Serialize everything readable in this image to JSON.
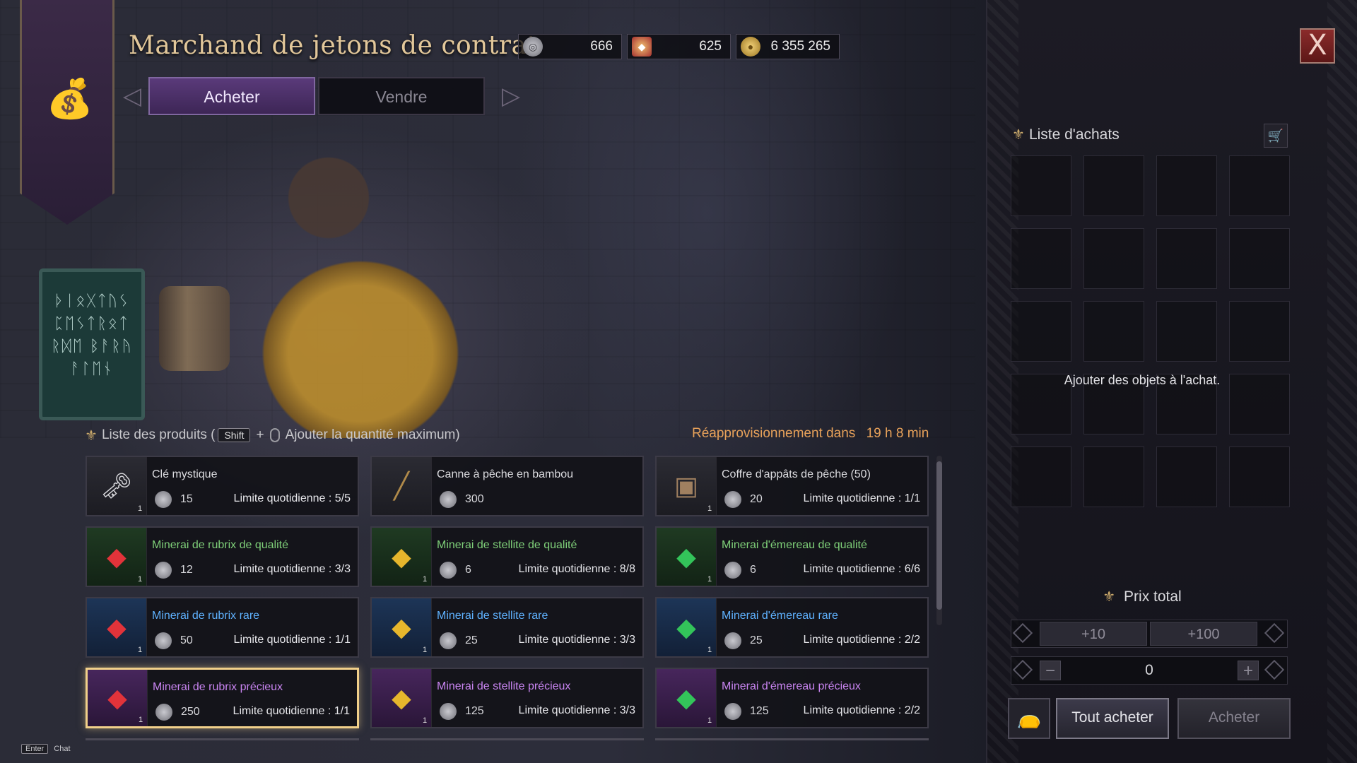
{
  "header": {
    "title": "Marchand de jetons de contrat",
    "currencies": [
      {
        "icon": "contract-token-icon",
        "value": "666"
      },
      {
        "icon": "ticket-icon",
        "value": "625"
      },
      {
        "icon": "gold-coin-icon",
        "value": "6 355 265"
      }
    ],
    "close_label": "X"
  },
  "tabs": {
    "buy": "Acheter",
    "sell": "Vendre"
  },
  "product_list": {
    "header_prefix": "Liste des produits (",
    "shift_key": "Shift",
    "plus": "+",
    "header_suffix": "Ajouter la quantité maximum)",
    "restock_label": "Réapprovisionnement dans",
    "restock_time": "19 h 8 min"
  },
  "items": [
    {
      "name": "Clé mystique",
      "price": "15",
      "limit": "Limite quotidienne : 5/5",
      "qty": "1",
      "grade": "normal",
      "icon": "key-icon"
    },
    {
      "name": "Canne à pêche en bambou",
      "price": "300",
      "limit": "",
      "qty": "",
      "grade": "normal",
      "icon": "fishing-rod-icon"
    },
    {
      "name": "Coffre d'appâts de pêche (50)",
      "price": "20",
      "limit": "Limite quotidienne : 1/1",
      "qty": "1",
      "grade": "normal",
      "icon": "bait-chest-icon"
    },
    {
      "name": "Minerai de rubrix de qualité",
      "price": "12",
      "limit": "Limite quotidienne : 3/3",
      "qty": "1",
      "grade": "green",
      "icon": "red-ore-icon"
    },
    {
      "name": "Minerai de stellite de qualité",
      "price": "6",
      "limit": "Limite quotidienne : 8/8",
      "qty": "1",
      "grade": "green",
      "icon": "yellow-ore-icon"
    },
    {
      "name": "Minerai d'émereau de qualité",
      "price": "6",
      "limit": "Limite quotidienne : 6/6",
      "qty": "1",
      "grade": "green",
      "icon": "green-ore-icon"
    },
    {
      "name": "Minerai de rubrix rare",
      "price": "50",
      "limit": "Limite quotidienne : 1/1",
      "qty": "1",
      "grade": "blue",
      "icon": "red-ore-icon"
    },
    {
      "name": "Minerai de stellite rare",
      "price": "25",
      "limit": "Limite quotidienne : 3/3",
      "qty": "1",
      "grade": "blue",
      "icon": "yellow-ore-icon"
    },
    {
      "name": "Minerai d'émereau rare",
      "price": "25",
      "limit": "Limite quotidienne : 2/2",
      "qty": "1",
      "grade": "blue",
      "icon": "green-ore-icon"
    },
    {
      "name": "Minerai de rubrix précieux",
      "price": "250",
      "limit": "Limite quotidienne : 1/1",
      "qty": "1",
      "grade": "purple",
      "icon": "red-ore-icon"
    },
    {
      "name": "Minerai de stellite précieux",
      "price": "125",
      "limit": "Limite quotidienne : 3/3",
      "qty": "1",
      "grade": "purple",
      "icon": "yellow-ore-icon"
    },
    {
      "name": "Minerai d'émereau précieux",
      "price": "125",
      "limit": "Limite quotidienne : 2/2",
      "qty": "1",
      "grade": "purple",
      "icon": "green-ore-icon"
    }
  ],
  "cart": {
    "title": "Liste d'achats",
    "empty_message": "Ajouter des objets à l'achat.",
    "total_title": "Prix total",
    "plus10": "+10",
    "plus100": "+100",
    "quantity": "0",
    "minus": "−",
    "plus": "+",
    "buy_all": "Tout acheter",
    "buy": "Acheter"
  },
  "chat": {
    "key": "Enter",
    "label": "Chat"
  },
  "colors": {
    "accent_gold": "#e2c79a",
    "tab_active": "#5a3a7a",
    "restock": "#e8a25a",
    "grade_green": "#7fd079",
    "grade_blue": "#5fb2ff",
    "grade_purple": "#c884f0"
  }
}
